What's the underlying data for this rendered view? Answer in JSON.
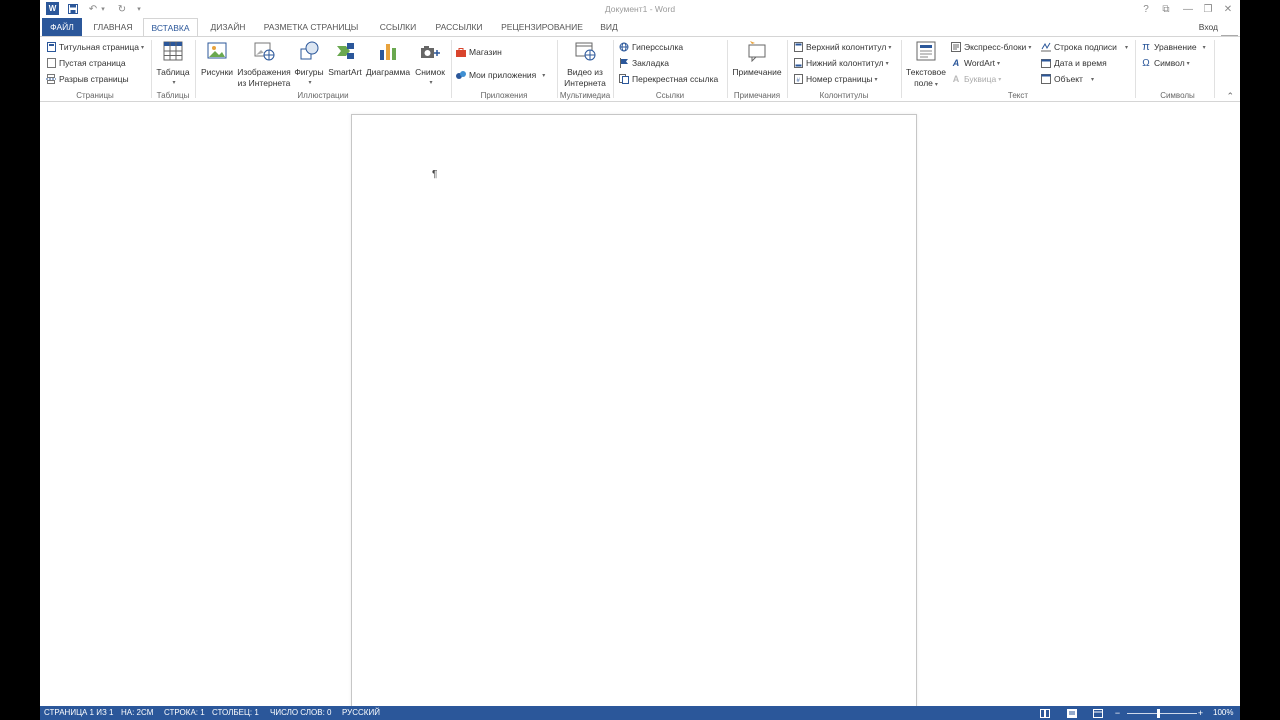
{
  "window": {
    "title": "Документ1 - Word",
    "help": "?",
    "ribbon_display": "⧉",
    "minimize": "—",
    "restore": "❐",
    "close": "✕",
    "signin": "Вход"
  },
  "quick_access": {
    "save": "💾",
    "undo": "↶",
    "undo_dd": "▾",
    "redo": "↻",
    "customize": "▾"
  },
  "tabs": [
    "ФАЙЛ",
    "ГЛАВНАЯ",
    "ВСТАВКА",
    "ДИЗАЙН",
    "РАЗМЕТКА СТРАНИЦЫ",
    "ССЫЛКИ",
    "РАССЫЛКИ",
    "РЕЦЕНЗИРОВАНИЕ",
    "ВИД"
  ],
  "active_tab": "ВСТАВКА",
  "ribbon": {
    "pages": {
      "group": "Страницы",
      "cover": "Титульная страница",
      "blank": "Пустая страница",
      "break": "Разрыв страницы"
    },
    "tables": {
      "group": "Таблицы",
      "table": "Таблица"
    },
    "illustrations": {
      "group": "Иллюстрации",
      "pictures": "Рисунки",
      "online_pictures_1": "Изображения",
      "online_pictures_2": "из Интернета",
      "shapes": "Фигуры",
      "smartart": "SmartArt",
      "chart": "Диаграмма",
      "screenshot": "Снимок"
    },
    "apps": {
      "group": "Приложения",
      "store": "Магазин",
      "my_apps": "Мои приложения"
    },
    "media": {
      "group": "Мультимедиа",
      "video_1": "Видео из",
      "video_2": "Интернета"
    },
    "links": {
      "group": "Ссылки",
      "hyperlink": "Гиперссылка",
      "bookmark": "Закладка",
      "cross_ref": "Перекрестная ссылка"
    },
    "comments": {
      "group": "Примечания",
      "comment": "Примечание"
    },
    "header_footer": {
      "group": "Колонтитулы",
      "header": "Верхний колонтитул",
      "footer": "Нижний колонтитул",
      "page_number": "Номер страницы"
    },
    "text": {
      "group": "Текст",
      "textbox_1": "Текстовое",
      "textbox_2": "поле",
      "quick_parts": "Экспресс-блоки",
      "wordart": "WordArt",
      "dropcap": "Буквица",
      "signature": "Строка подписи",
      "datetime": "Дата и время",
      "object": "Объект"
    },
    "symbols": {
      "group": "Символы",
      "equation": "Уравнение",
      "symbol": "Символ"
    }
  },
  "document": {
    "pilcrow": "¶"
  },
  "status": {
    "page": "СТРАНИЦА 1 ИЗ 1",
    "at": "НА: 2СМ",
    "line": "СТРОКА: 1",
    "column": "СТОЛБЕЦ: 1",
    "words": "ЧИСЛО СЛОВ: 0",
    "language": "РУССКИЙ",
    "zoom_minus": "−",
    "zoom_plus": "+",
    "zoom": "100%"
  },
  "colors": {
    "accent": "#2b579a"
  }
}
